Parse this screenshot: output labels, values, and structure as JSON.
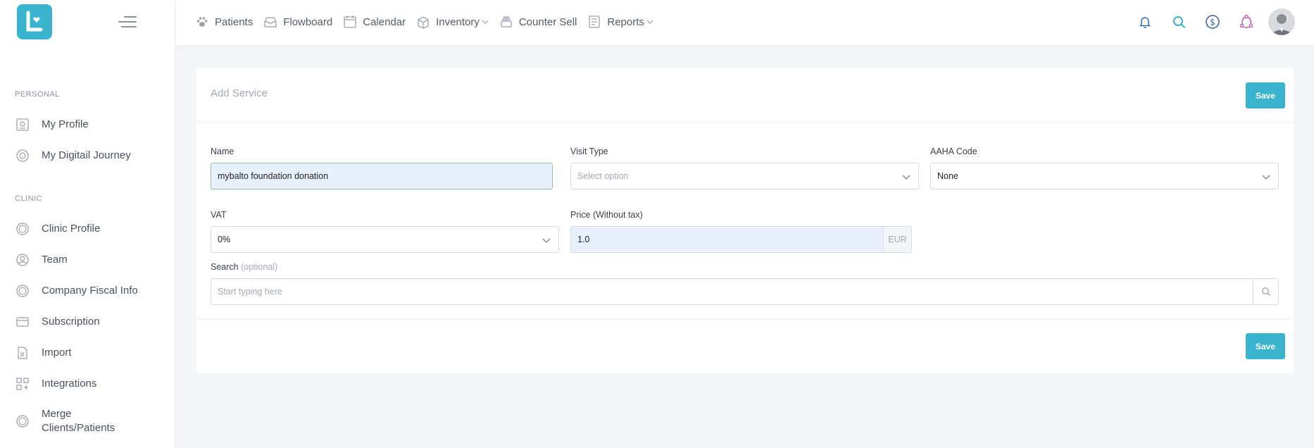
{
  "sidebar": {
    "sections": [
      {
        "label": "PERSONAL"
      },
      {
        "label": "CLINIC"
      }
    ],
    "items": [
      {
        "label": "My Profile",
        "icon": "profile-card-icon"
      },
      {
        "label": "My Digitail Journey",
        "icon": "journey-icon"
      },
      {
        "label": "Clinic Profile",
        "icon": "clinic-coin-icon"
      },
      {
        "label": "Team",
        "icon": "team-user-icon"
      },
      {
        "label": "Company Fiscal Info",
        "icon": "fiscal-coin-icon"
      },
      {
        "label": "Subscription",
        "icon": "credit-card-icon"
      },
      {
        "label": "Import",
        "icon": "excel-file-icon"
      },
      {
        "label": "Integrations",
        "icon": "integrations-grid-icon"
      },
      {
        "label": "Merge Clients/Patients",
        "icon": "merge-coin-icon"
      }
    ]
  },
  "topnav": {
    "items": [
      {
        "label": "Patients",
        "icon": "paw-icon",
        "dropdown": false
      },
      {
        "label": "Flowboard",
        "icon": "inbox-tray-icon",
        "dropdown": false
      },
      {
        "label": "Calendar",
        "icon": "calendar-icon",
        "dropdown": false
      },
      {
        "label": "Inventory",
        "icon": "box-icon",
        "dropdown": true
      },
      {
        "label": "Counter Sell",
        "icon": "cash-stack-icon",
        "dropdown": false
      },
      {
        "label": "Reports",
        "icon": "report-icon",
        "dropdown": true
      }
    ],
    "right_icons": [
      "bell-icon",
      "search-icon",
      "dollar-icon",
      "share-network-icon",
      "avatar"
    ]
  },
  "form": {
    "title": "Add Service",
    "save_label": "Save",
    "name": {
      "label": "Name",
      "value": "mybalto foundation donation"
    },
    "visit_type": {
      "label": "Visit Type",
      "placeholder": "Select option"
    },
    "aaha_code": {
      "label": "AAHA Code",
      "value": "None"
    },
    "vat": {
      "label": "VAT",
      "value": "0%"
    },
    "price": {
      "label": "Price (Without tax)",
      "value": "1.0",
      "currency": "EUR"
    },
    "search": {
      "label": "Search",
      "label_optional": "(optional)",
      "placeholder": "Start typing here"
    }
  },
  "colors": {
    "accent": "#3ab3cf",
    "background": "#f3f6f9",
    "autofill": "#e8f0fe"
  }
}
